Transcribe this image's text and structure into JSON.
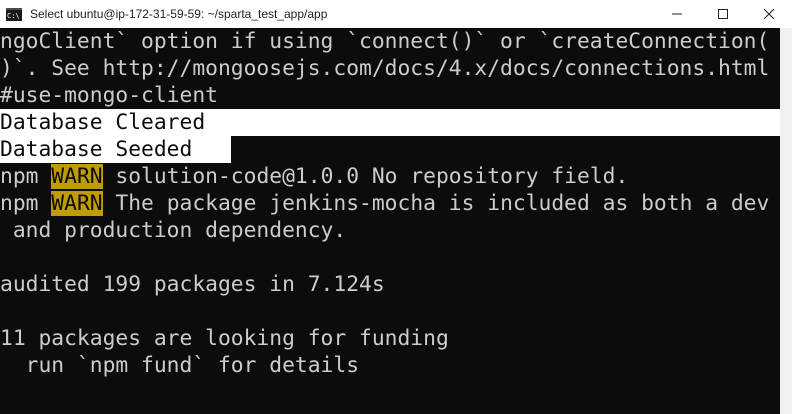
{
  "window": {
    "title": "Select ubuntu@ip-172-31-59-59: ~/sparta_test_app/app",
    "icon_label": "C:\\",
    "minimize_icon": "minimize-icon",
    "maximize_icon": "maximize-icon",
    "close_icon": "close-icon"
  },
  "terminal": {
    "lines": [
      "ngoClient` option if using `connect()` or `createConnection(",
      ")`. See http://mongoosejs.com/docs/4.x/docs/connections.html",
      "#use-mongo-client",
      "Database Cleared",
      "Database Seeded",
      "npm ",
      "WARN",
      " solution-code@1.0.0 No repository field.",
      "npm ",
      "WARN",
      " The package jenkins-mocha is included as both a dev",
      " and production dependency.",
      "audited 199 packages in 7.124s",
      "11 packages are looking for funding",
      "  run `npm fund` for details"
    ]
  },
  "colors": {
    "background": "#0c0c0c",
    "foreground": "#cccccc",
    "selection": "#ffffff",
    "warn_highlight": "#c19c00"
  }
}
